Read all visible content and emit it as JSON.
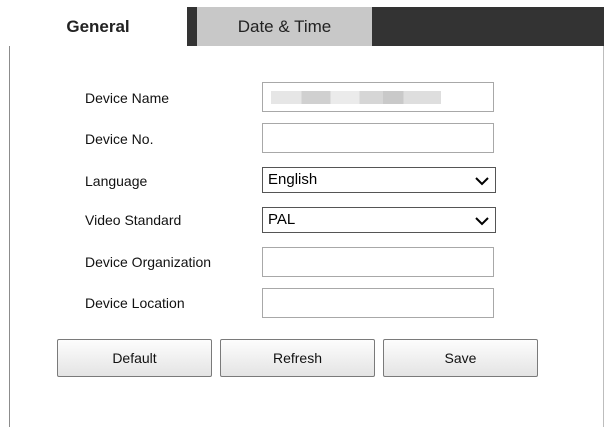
{
  "tabs": [
    {
      "label": "General",
      "active": true
    },
    {
      "label": "Date & Time",
      "active": false
    }
  ],
  "form": {
    "device_name": {
      "label": "Device Name",
      "value": ""
    },
    "device_no": {
      "label": "Device No.",
      "value": ""
    },
    "language": {
      "label": "Language",
      "selected": "English"
    },
    "video_standard": {
      "label": "Video Standard",
      "selected": "PAL"
    },
    "device_organization": {
      "label": "Device Organization",
      "value": ""
    },
    "device_location": {
      "label": "Device Location",
      "value": ""
    }
  },
  "buttons": {
    "default": "Default",
    "refresh": "Refresh",
    "save": "Save"
  },
  "icons": {
    "select_arrow": "chevron-down-icon"
  }
}
